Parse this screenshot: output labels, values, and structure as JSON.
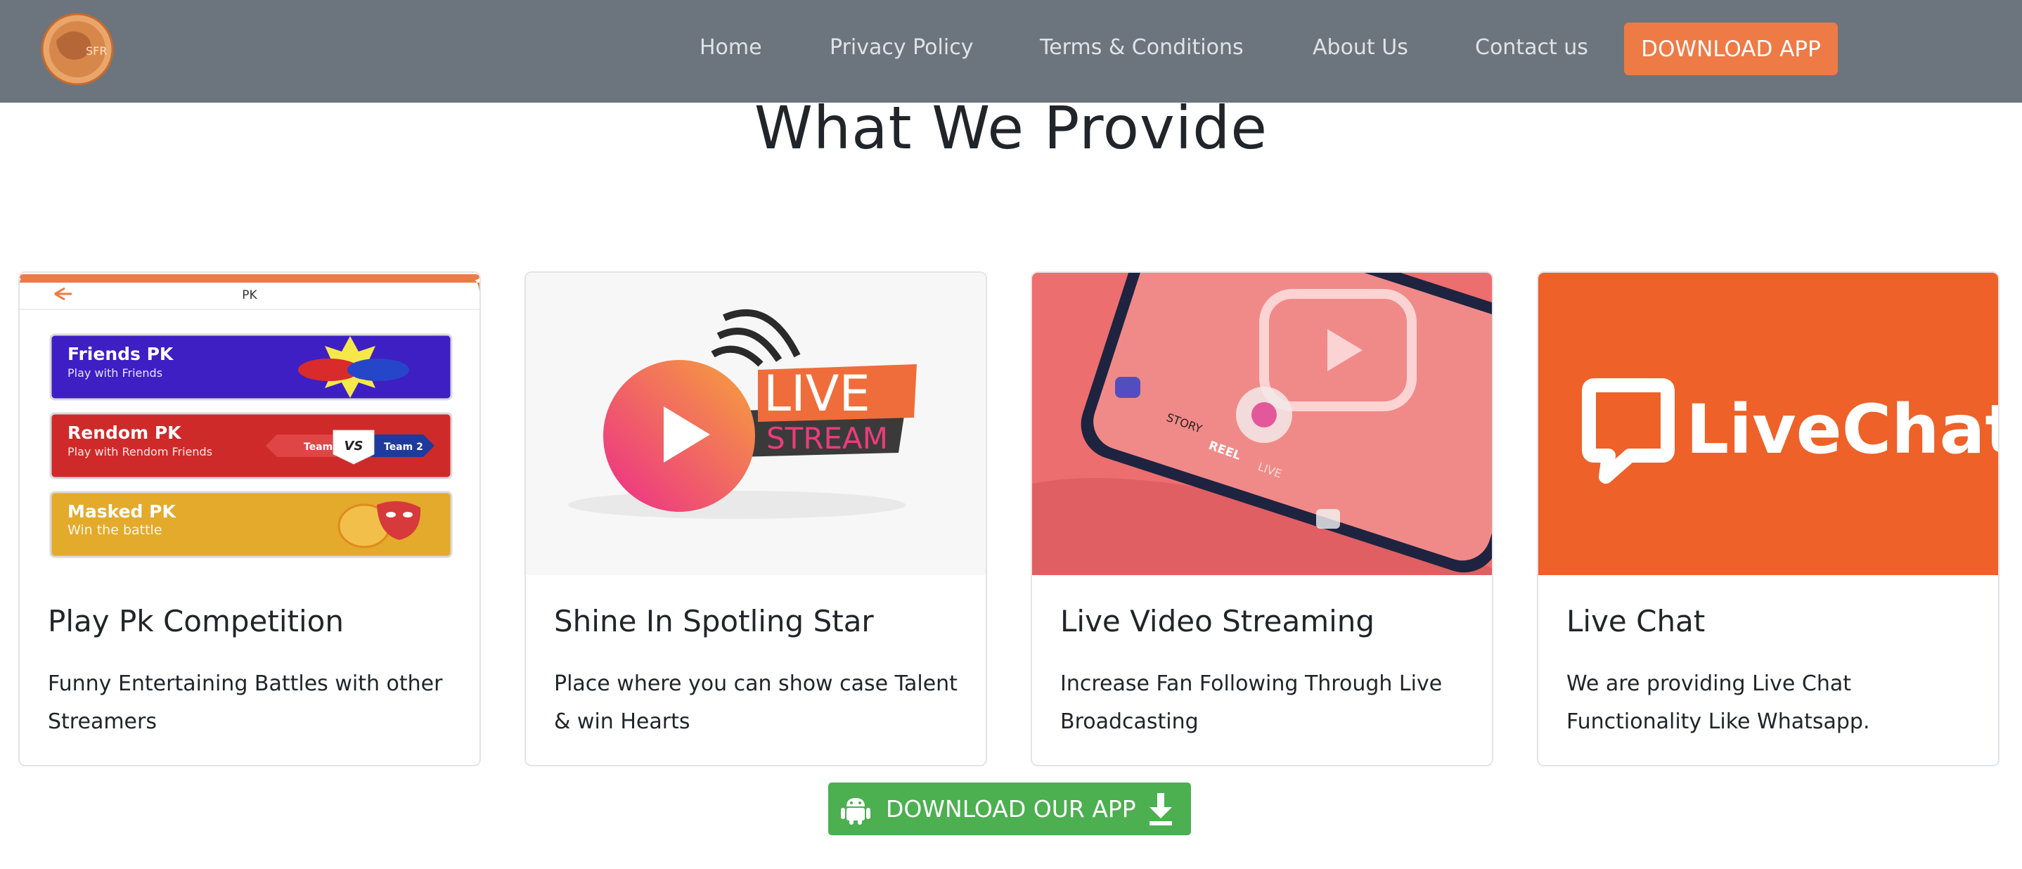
{
  "nav": {
    "logo_alt": "app-logo",
    "links": [
      "Home",
      "Privacy Policy",
      "Terms & Conditions",
      "About Us",
      "Contact us"
    ],
    "download_label": "DOWNLOAD APP"
  },
  "section": {
    "title": "What We Provide"
  },
  "cards": [
    {
      "title": "Play Pk Competition",
      "text": "Funny Entertaining Battles with other Streamers",
      "image": {
        "header": "PK",
        "items": [
          {
            "title": "Friends PK",
            "sub": "Play with Friends"
          },
          {
            "title": "Rendom PK",
            "sub": "Play with Rendom Friends",
            "team1": "Team 1",
            "vs": "VS",
            "team2": "Team 2"
          },
          {
            "title": "Masked PK",
            "sub": "Win the battle"
          }
        ]
      }
    },
    {
      "title": "Shine In Spotling Star",
      "text": "Place where you can show case Talent & win Hearts",
      "image": {
        "word1": "LIVE",
        "word2": "STREAM"
      }
    },
    {
      "title": "Live Video Streaming",
      "text": "Increase Fan Following Through Live Broadcasting",
      "image": {
        "modes": [
          "STORY",
          "REEL",
          "LIVE"
        ]
      }
    },
    {
      "title": "Live Chat",
      "text": "We are providing Live Chat Functionality Like Whatsapp.",
      "image": {
        "brand": "LiveChat"
      }
    }
  ],
  "download_app_label": "DOWNLOAD OUR APP",
  "colors": {
    "navbar": "#6c757d",
    "accent_orange": "#ee7a46",
    "download_green": "#4caf50",
    "livechat_orange": "#ee6128"
  }
}
